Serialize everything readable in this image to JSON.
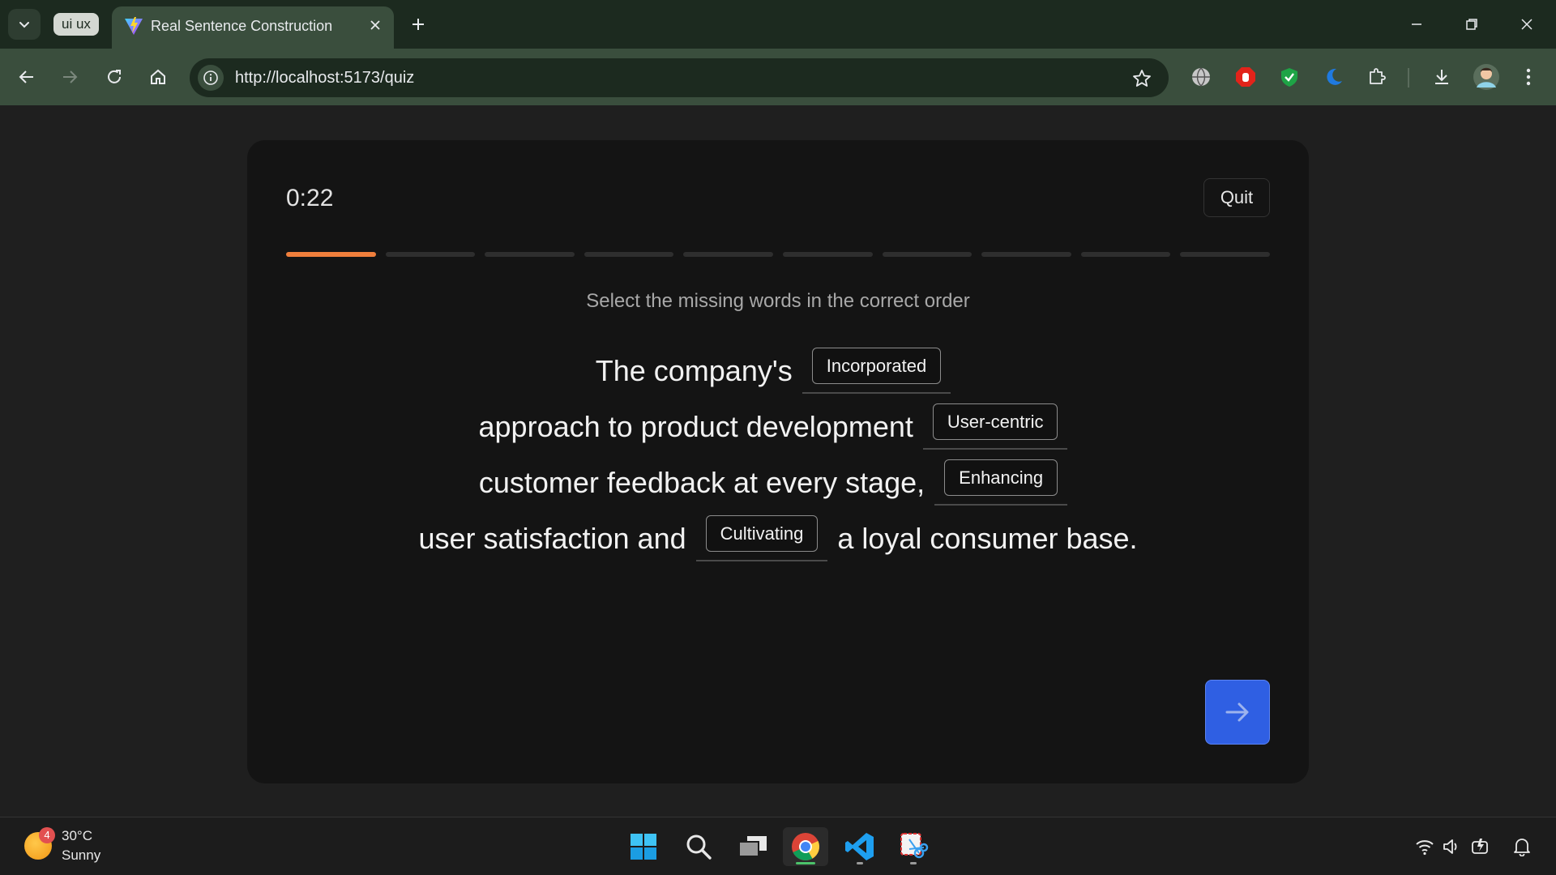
{
  "browser": {
    "tab_group_label": "ui ux",
    "tab_title": "Real Sentence Construction",
    "url": "http://localhost:5173/quiz"
  },
  "quiz": {
    "timer": "0:22",
    "quit_label": "Quit",
    "progress": {
      "total": 10,
      "current": 1
    },
    "instruction": "Select the missing words in the correct order",
    "sentence": {
      "line1_text": "The company's",
      "blank1": "Incorporated",
      "line2_text": "approach to product development",
      "blank2": "User-centric",
      "line3_text": "customer feedback at every stage,",
      "blank3": "Enhancing",
      "line4_text": "user satisfaction and",
      "blank4": "Cultivating",
      "line4_tail": "a loyal consumer base."
    },
    "next_icon": "arrow-right-icon"
  },
  "taskbar": {
    "weather_badge": "4",
    "weather_temp": "30°C",
    "weather_condition": "Sunny"
  },
  "colors": {
    "accent_progress": "#f07f3c",
    "next_button": "#2f5fe3",
    "card_bg": "#141414",
    "page_bg": "#1f1f1f"
  }
}
